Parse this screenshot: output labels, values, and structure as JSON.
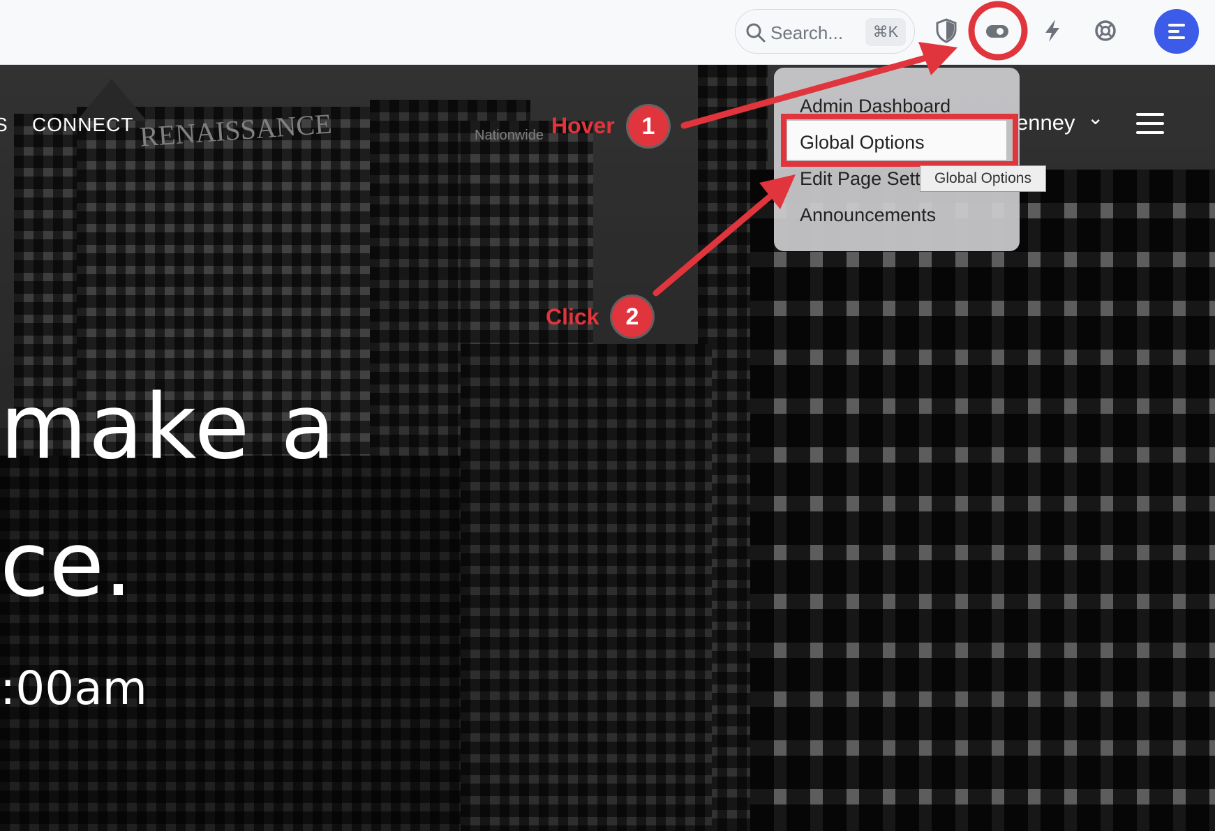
{
  "toolbar": {
    "search_placeholder": "Search...",
    "search_shortcut": "⌘K",
    "icons": [
      "shield-icon",
      "eye-toggle-icon",
      "bolt-icon",
      "help-lifebuoy-icon",
      "avatar-menu-icon"
    ]
  },
  "hero_nav": {
    "cut_item": "S",
    "connect_label": "CONNECT",
    "user_label": "enney",
    "user_chevron": "⌄"
  },
  "hero": {
    "line1": "make a",
    "line2": "ce.",
    "line3": ":00am"
  },
  "dropdown": {
    "items": [
      "Admin Dashboard",
      "Global Options",
      "Edit Page Sett",
      "Announcements"
    ],
    "tooltip": "Global Options"
  },
  "annotations": {
    "step1_label": "Hover",
    "step1_number": "1",
    "step2_label": "Click",
    "step2_number": "2",
    "color": "#e0353d"
  },
  "colors": {
    "accent": "#3b5be8",
    "annotation": "#e0353d",
    "toolbar_bg": "#f8f9fb"
  }
}
